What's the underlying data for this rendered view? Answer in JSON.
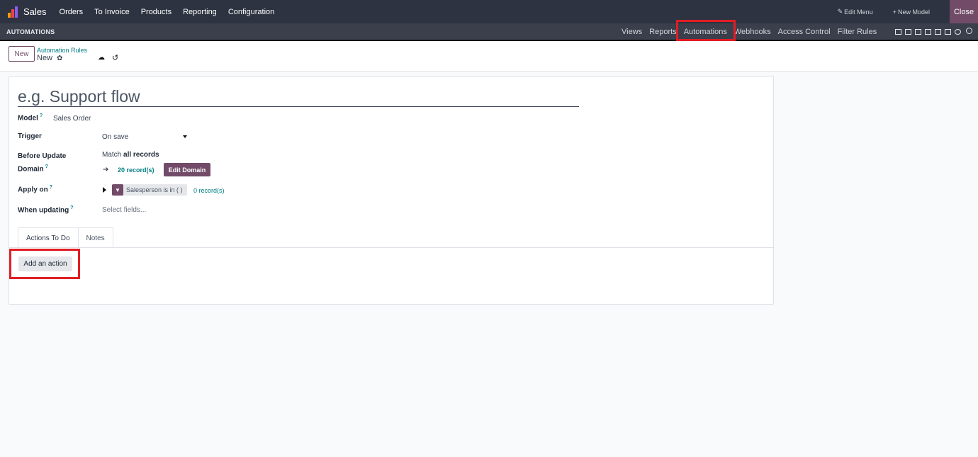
{
  "app": {
    "name": "Sales"
  },
  "menu": [
    "Orders",
    "To Invoice",
    "Products",
    "Reporting",
    "Configuration"
  ],
  "topright": {
    "edit_menu": "Edit Menu",
    "new_model": "New Model",
    "close": "Close"
  },
  "studio": {
    "title": "AUTOMATIONS",
    "tabs": [
      "Views",
      "Reports",
      "Automations",
      "Webhooks",
      "Access Control",
      "Filter Rules"
    ],
    "active_tab": "Automations"
  },
  "control": {
    "new_label": "New",
    "breadcrumb_parent": "Automation Rules",
    "breadcrumb_current": "New"
  },
  "form": {
    "name_placeholder": "e.g. Support flow",
    "model_label": "Model",
    "model_value": "Sales Order",
    "trigger_label": "Trigger",
    "trigger_value": "On save",
    "before_update_label": "Before Update Domain",
    "match_prefix": "Match",
    "match_value": "all records",
    "records_count": "20 record(s)",
    "edit_domain": "Edit Domain",
    "apply_on_label": "Apply on",
    "apply_filter": "Salesperson is in ( )",
    "apply_records": "0 record(s)",
    "when_updating_label": "When updating",
    "when_updating_placeholder": "Select fields..."
  },
  "tabs": [
    "Actions To Do",
    "Notes"
  ],
  "add_action": "Add an action",
  "colors": {
    "brand": "#714b67",
    "link": "#017e84",
    "highlight": "#e11d24",
    "navbar": "#2d3340"
  }
}
